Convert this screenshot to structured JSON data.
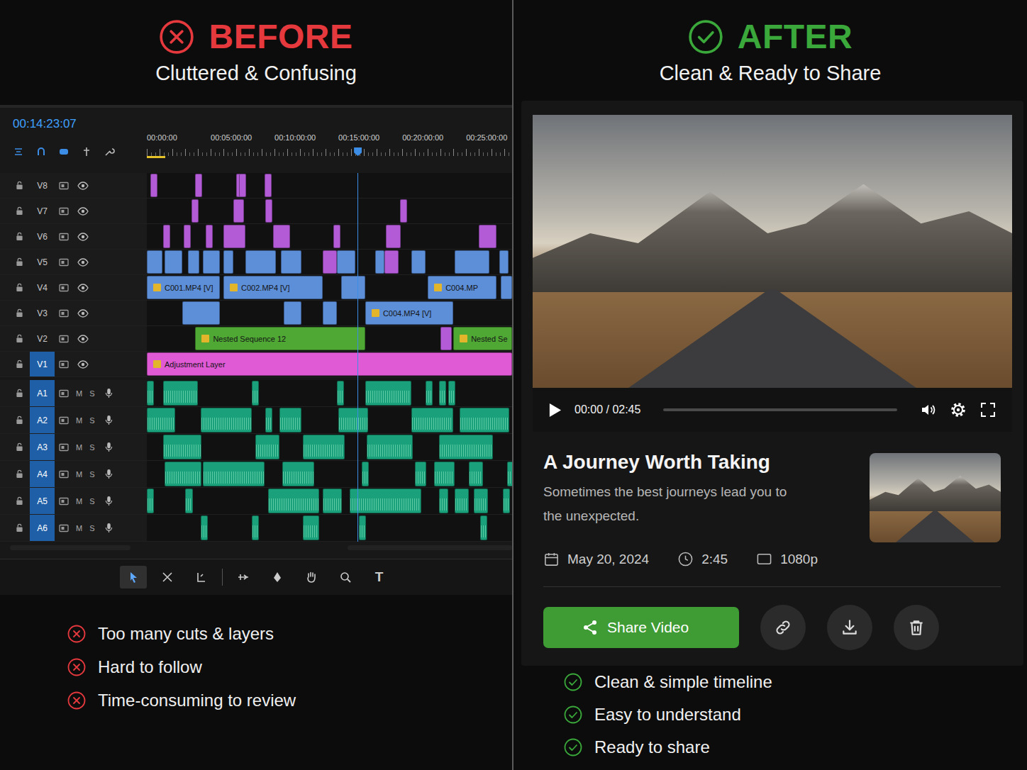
{
  "before": {
    "badge": "BEFORE",
    "subtitle": "Cluttered & Confusing",
    "editor": {
      "timecode": "00:14:23:07",
      "playhead": 16.5,
      "ruler": [
        {
          "label": "00:00:00",
          "minute": 0
        },
        {
          "label": "00:05:00:00",
          "minute": 5
        },
        {
          "label": "00:10:00:00",
          "minute": 10
        },
        {
          "label": "00:15:00:00",
          "minute": 15
        },
        {
          "label": "00:20:00:00",
          "minute": 20
        },
        {
          "label": "00:25:00:00",
          "minute": 25
        }
      ],
      "audio_buttons": [
        "M",
        "S"
      ],
      "tracks": [
        {
          "name": "V8",
          "kind": "video",
          "targeted": false,
          "clips": [
            {
              "start": 0.3,
              "end": 0.45,
              "color": "#b35bd6"
            },
            {
              "start": 3.8,
              "end": 3.95,
              "color": "#b35bd6"
            },
            {
              "start": 7.0,
              "end": 7.15,
              "color": "#b35bd6"
            },
            {
              "start": 7.2,
              "end": 7.35,
              "color": "#b35bd6"
            },
            {
              "start": 9.2,
              "end": 9.35,
              "color": "#b35bd6"
            }
          ]
        },
        {
          "name": "V7",
          "kind": "video",
          "targeted": false,
          "clips": [
            {
              "start": 3.5,
              "end": 3.65,
              "color": "#b35bd6"
            },
            {
              "start": 6.8,
              "end": 7.6,
              "color": "#b35bd6"
            },
            {
              "start": 9.3,
              "end": 9.45,
              "color": "#b35bd6"
            },
            {
              "start": 19.8,
              "end": 19.95,
              "color": "#b35bd6"
            }
          ]
        },
        {
          "name": "V6",
          "kind": "video",
          "targeted": false,
          "clips": [
            {
              "start": 1.3,
              "end": 1.6,
              "color": "#b35bd6"
            },
            {
              "start": 2.9,
              "end": 3.4,
              "color": "#b35bd6"
            },
            {
              "start": 4.6,
              "end": 4.9,
              "color": "#b35bd6"
            },
            {
              "start": 6.0,
              "end": 7.7,
              "color": "#b35bd6"
            },
            {
              "start": 9.9,
              "end": 11.2,
              "color": "#b35bd6"
            },
            {
              "start": 14.6,
              "end": 14.9,
              "color": "#b35bd6"
            },
            {
              "start": 18.7,
              "end": 19.9,
              "color": "#b35bd6"
            },
            {
              "start": 26.0,
              "end": 27.4,
              "color": "#b35bd6"
            }
          ]
        },
        {
          "name": "V5",
          "kind": "video",
          "targeted": false,
          "clips": [
            {
              "start": 0,
              "end": 1.2,
              "color": "#5d8fd9"
            },
            {
              "start": 1.4,
              "end": 2.8,
              "color": "#5d8fd9"
            },
            {
              "start": 3.2,
              "end": 4.1,
              "color": "#5d8fd9"
            },
            {
              "start": 4.4,
              "end": 5.7,
              "color": "#5d8fd9"
            },
            {
              "start": 6.0,
              "end": 6.8,
              "color": "#5d8fd9"
            },
            {
              "start": 7.7,
              "end": 10.1,
              "color": "#5d8fd9"
            },
            {
              "start": 10.5,
              "end": 12.1,
              "color": "#5d8fd9"
            },
            {
              "start": 13.8,
              "end": 14.9,
              "color": "#b35bd6"
            },
            {
              "start": 14.9,
              "end": 16.3,
              "color": "#5d8fd9"
            },
            {
              "start": 17.9,
              "end": 18.6,
              "color": "#5d8fd9"
            },
            {
              "start": 18.6,
              "end": 19.7,
              "color": "#b35bd6"
            },
            {
              "start": 20.7,
              "end": 21.8,
              "color": "#5d8fd9"
            },
            {
              "start": 24.1,
              "end": 26.8,
              "color": "#5d8fd9"
            },
            {
              "start": 27.6,
              "end": 28.3,
              "color": "#5d8fd9"
            }
          ]
        },
        {
          "name": "V4",
          "kind": "video",
          "targeted": false,
          "clips": [
            {
              "start": 0,
              "end": 5.7,
              "color": "#5d8fd9",
              "label": "C001.MP4 [V]"
            },
            {
              "start": 6.0,
              "end": 13.8,
              "color": "#5d8fd9",
              "label": "C002.MP4 [V]"
            },
            {
              "start": 15.2,
              "end": 17.1,
              "color": "#5d8fd9"
            },
            {
              "start": 22.0,
              "end": 27.4,
              "color": "#5d8fd9",
              "label": "C004.MP"
            },
            {
              "start": 27.7,
              "end": 28.6,
              "color": "#5d8fd9"
            }
          ]
        },
        {
          "name": "V3",
          "kind": "video",
          "targeted": false,
          "clips": [
            {
              "start": 2.8,
              "end": 5.7,
              "color": "#5d8fd9"
            },
            {
              "start": 10.7,
              "end": 12.1,
              "color": "#5d8fd9"
            },
            {
              "start": 13.8,
              "end": 14.9,
              "color": "#5d8fd9"
            },
            {
              "start": 17.1,
              "end": 24.0,
              "color": "#5d8fd9",
              "label": "C004.MP4 [V]"
            }
          ]
        },
        {
          "name": "V2",
          "kind": "video",
          "targeted": false,
          "clips": [
            {
              "start": 3.8,
              "end": 17.1,
              "color": "#4fa834",
              "label": "Nested Sequence 12"
            },
            {
              "start": 23.0,
              "end": 23.9,
              "color": "#b35bd6"
            },
            {
              "start": 24.0,
              "end": 28.6,
              "color": "#4fa834",
              "label": "Nested Se"
            }
          ]
        },
        {
          "name": "V1",
          "kind": "video",
          "targeted": true,
          "clips": [
            {
              "start": 0,
              "end": 28.6,
              "color": "#e05ad6",
              "label": "Adjustment Layer"
            }
          ]
        },
        {
          "name": "A1",
          "kind": "audio",
          "targeted": true,
          "clips": [
            {
              "start": 0,
              "end": 0.3,
              "color": "#1aa07a"
            },
            {
              "start": 1.3,
              "end": 4.0,
              "color": "#1aa07a"
            },
            {
              "start": 8.2,
              "end": 8.6,
              "color": "#1aa07a"
            },
            {
              "start": 14.9,
              "end": 15.2,
              "color": "#1aa07a"
            },
            {
              "start": 17.1,
              "end": 20.7,
              "color": "#1aa07a"
            },
            {
              "start": 21.8,
              "end": 22.3,
              "color": "#1aa07a"
            },
            {
              "start": 22.9,
              "end": 23.2,
              "color": "#1aa07a"
            },
            {
              "start": 23.6,
              "end": 23.9,
              "color": "#1aa07a"
            }
          ]
        },
        {
          "name": "A2",
          "kind": "audio",
          "targeted": true,
          "clips": [
            {
              "start": 0,
              "end": 2.2,
              "color": "#1aa07a"
            },
            {
              "start": 4.2,
              "end": 8.2,
              "color": "#1aa07a"
            },
            {
              "start": 9.3,
              "end": 9.6,
              "color": "#1aa07a"
            },
            {
              "start": 10.4,
              "end": 12.1,
              "color": "#1aa07a"
            },
            {
              "start": 15.0,
              "end": 17.3,
              "color": "#1aa07a"
            },
            {
              "start": 20.7,
              "end": 24.0,
              "color": "#1aa07a"
            },
            {
              "start": 24.5,
              "end": 28.4,
              "color": "#1aa07a"
            }
          ]
        },
        {
          "name": "A3",
          "kind": "audio",
          "targeted": true,
          "clips": [
            {
              "start": 1.3,
              "end": 4.3,
              "color": "#1aa07a"
            },
            {
              "start": 8.5,
              "end": 10.4,
              "color": "#1aa07a"
            },
            {
              "start": 12.2,
              "end": 15.5,
              "color": "#1aa07a"
            },
            {
              "start": 17.2,
              "end": 20.8,
              "color": "#1aa07a"
            },
            {
              "start": 22.9,
              "end": 27.1,
              "color": "#1aa07a"
            }
          ]
        },
        {
          "name": "A4",
          "kind": "audio",
          "targeted": true,
          "clips": [
            {
              "start": 1.4,
              "end": 4.3,
              "color": "#1aa07a"
            },
            {
              "start": 4.4,
              "end": 9.2,
              "color": "#1aa07a"
            },
            {
              "start": 10.6,
              "end": 13.1,
              "color": "#1aa07a"
            },
            {
              "start": 16.8,
              "end": 17.1,
              "color": "#1aa07a"
            },
            {
              "start": 21.0,
              "end": 21.9,
              "color": "#1aa07a"
            },
            {
              "start": 22.5,
              "end": 24.1,
              "color": "#1aa07a"
            },
            {
              "start": 25.2,
              "end": 26.3,
              "color": "#1aa07a"
            },
            {
              "start": 28.2,
              "end": 28.5,
              "color": "#1aa07a"
            }
          ]
        },
        {
          "name": "A5",
          "kind": "audio",
          "targeted": true,
          "clips": [
            {
              "start": 0,
              "end": 0.4,
              "color": "#1aa07a"
            },
            {
              "start": 3.0,
              "end": 3.6,
              "color": "#1aa07a"
            },
            {
              "start": 9.5,
              "end": 13.5,
              "color": "#1aa07a"
            },
            {
              "start": 13.8,
              "end": 15.3,
              "color": "#1aa07a"
            },
            {
              "start": 15.9,
              "end": 21.5,
              "color": "#1aa07a"
            },
            {
              "start": 22.9,
              "end": 23.6,
              "color": "#1aa07a"
            },
            {
              "start": 24.1,
              "end": 25.2,
              "color": "#1aa07a"
            },
            {
              "start": 25.6,
              "end": 26.7,
              "color": "#1aa07a"
            },
            {
              "start": 27.9,
              "end": 28.4,
              "color": "#1aa07a"
            }
          ]
        },
        {
          "name": "A6",
          "kind": "audio",
          "targeted": true,
          "clips": [
            {
              "start": 4.2,
              "end": 4.6,
              "color": "#1aa07a"
            },
            {
              "start": 8.2,
              "end": 8.6,
              "color": "#1aa07a"
            },
            {
              "start": 12.2,
              "end": 13.5,
              "color": "#1aa07a"
            },
            {
              "start": 16.6,
              "end": 17.0,
              "color": "#1aa07a"
            },
            {
              "start": 26.1,
              "end": 26.3,
              "color": "#1aa07a"
            }
          ]
        }
      ],
      "tools": [
        {
          "kind": "select",
          "selected": true
        },
        {
          "kind": "track-select",
          "selected": false
        },
        {
          "kind": "ripple",
          "selected": false
        },
        {
          "kind": "slip",
          "selected": false
        },
        {
          "kind": "pen",
          "selected": false
        },
        {
          "kind": "hand",
          "selected": false
        },
        {
          "kind": "zoom",
          "selected": false
        },
        {
          "kind": "type",
          "selected": false,
          "glyph": "T"
        }
      ]
    },
    "points": [
      "Too many cuts & layers",
      "Hard to follow",
      "Time-consuming to review"
    ]
  },
  "after": {
    "badge": "AFTER",
    "subtitle": "Clean & Ready to Share",
    "player": {
      "time": "00:00 / 02:45",
      "level": 0
    },
    "video": {
      "title": "A Journey Worth Taking",
      "description": "Sometimes the best journeys lead you to the unexpected.",
      "date": "May 20, 2024",
      "duration": "2:45",
      "resolution": "1080p"
    },
    "share": "Share Video",
    "points": [
      "Clean & simple timeline",
      "Easy to understand",
      "Ready to share"
    ]
  }
}
